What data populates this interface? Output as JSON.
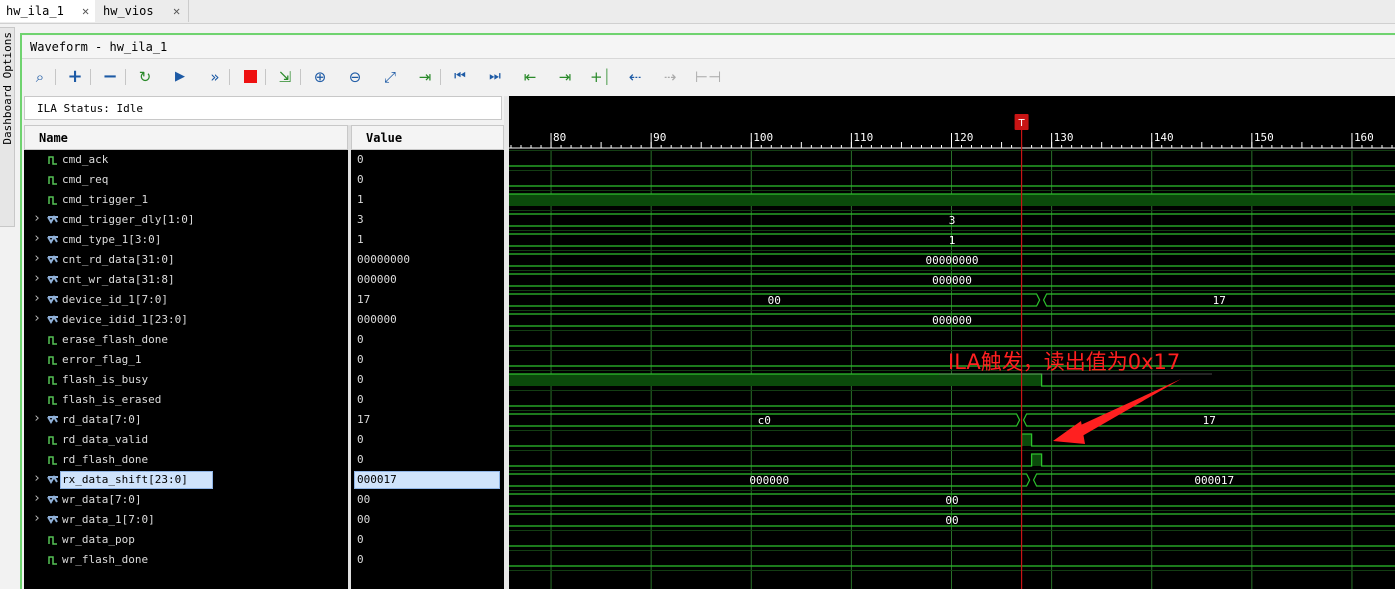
{
  "tabs": [
    {
      "label": "hw_ila_1",
      "active": true
    },
    {
      "label": "hw_vios",
      "active": false
    }
  ],
  "side_panel": {
    "label": "Dashboard Options"
  },
  "window": {
    "title": "Waveform - hw_ila_1"
  },
  "toolbar": {
    "buttons": [
      "search-icon",
      "plus-icon",
      "minus-icon",
      "reset-icon",
      "run-icon",
      "run-all-icon",
      "stop-icon",
      "export-icon",
      "zoom-in-icon",
      "zoom-out-icon",
      "zoom-fit-icon",
      "go-to-cursor-icon",
      "first-icon",
      "last-icon",
      "prev-transition-icon",
      "next-transition-icon",
      "add-marker-icon",
      "prev-marker-icon",
      "next-marker-icon",
      "swap-cursors-icon"
    ]
  },
  "status": {
    "text": "ILA Status: Idle"
  },
  "columns": {
    "name": "Name",
    "value": "Value"
  },
  "signals": [
    {
      "name": "cmd_ack",
      "value": "0",
      "type": "bit",
      "bus": false,
      "wave": [
        [
          60,
          "0"
        ]
      ]
    },
    {
      "name": "cmd_req",
      "value": "0",
      "type": "bit",
      "bus": false,
      "wave": [
        [
          60,
          "0"
        ]
      ]
    },
    {
      "name": "cmd_trigger_1",
      "value": "1",
      "type": "bit",
      "bus": false,
      "wave": [
        [
          60,
          "1"
        ]
      ]
    },
    {
      "name": "cmd_trigger_dly[1:0]",
      "value": "3",
      "type": "bus",
      "bus": true,
      "wave": [
        [
          60,
          "3"
        ]
      ]
    },
    {
      "name": "cmd_type_1[3:0]",
      "value": "1",
      "type": "bus",
      "bus": true,
      "wave": [
        [
          60,
          "1"
        ]
      ]
    },
    {
      "name": "cnt_rd_data[31:0]",
      "value": "00000000",
      "type": "bus",
      "bus": true,
      "wave": [
        [
          60,
          "00000000"
        ]
      ]
    },
    {
      "name": "cnt_wr_data[31:8]",
      "value": "000000",
      "type": "bus",
      "bus": true,
      "wave": [
        [
          60,
          "000000"
        ]
      ]
    },
    {
      "name": "device_id_1[7:0]",
      "value": "17",
      "type": "bus",
      "bus": true,
      "wave": [
        [
          60,
          "00"
        ],
        [
          129,
          "17"
        ]
      ]
    },
    {
      "name": "device_idid_1[23:0]",
      "value": "000000",
      "type": "bus",
      "bus": true,
      "wave": [
        [
          60,
          "000000"
        ]
      ]
    },
    {
      "name": "erase_flash_done",
      "value": "0",
      "type": "bit",
      "bus": false,
      "wave": [
        [
          60,
          "0"
        ]
      ]
    },
    {
      "name": "error_flag_1",
      "value": "0",
      "type": "bit",
      "bus": false,
      "wave": [
        [
          60,
          "0"
        ]
      ]
    },
    {
      "name": "flash_is_busy",
      "value": "0",
      "type": "bit",
      "bus": false,
      "wave": [
        [
          60,
          "1"
        ],
        [
          129,
          "0"
        ]
      ]
    },
    {
      "name": "flash_is_erased",
      "value": "0",
      "type": "bit",
      "bus": false,
      "wave": [
        [
          60,
          "0"
        ]
      ]
    },
    {
      "name": "rd_data[7:0]",
      "value": "17",
      "type": "bus",
      "bus": true,
      "wave": [
        [
          60,
          "c0"
        ],
        [
          127,
          "17"
        ]
      ]
    },
    {
      "name": "rd_data_valid",
      "value": "0",
      "type": "bit",
      "bus": false,
      "wave": [
        [
          60,
          "0"
        ],
        [
          127,
          "1"
        ],
        [
          128,
          "0"
        ]
      ]
    },
    {
      "name": "rd_flash_done",
      "value": "0",
      "type": "bit",
      "bus": false,
      "wave": [
        [
          60,
          "0"
        ],
        [
          128,
          "1"
        ],
        [
          129,
          "0"
        ]
      ]
    },
    {
      "name": "rx_data_shift[23:0]",
      "value": "000017",
      "type": "bus",
      "bus": true,
      "selected": true,
      "wave": [
        [
          60,
          "000000"
        ],
        [
          128,
          "000017"
        ]
      ]
    },
    {
      "name": "wr_data[7:0]",
      "value": "00",
      "type": "bus",
      "bus": true,
      "wave": [
        [
          60,
          "00"
        ]
      ]
    },
    {
      "name": "wr_data_1[7:0]",
      "value": "00",
      "type": "bus",
      "bus": true,
      "wave": [
        [
          60,
          "00"
        ]
      ]
    },
    {
      "name": "wr_data_pop",
      "value": "0",
      "type": "bit",
      "bus": false,
      "wave": [
        [
          60,
          "0"
        ]
      ]
    },
    {
      "name": "wr_flash_done",
      "value": "0",
      "type": "bit",
      "bus": false,
      "wave": [
        [
          60,
          "0"
        ]
      ]
    }
  ],
  "timeline": {
    "start": 75.8,
    "end": 164.3,
    "ticks": [
      80,
      90,
      100,
      110,
      120,
      130,
      140,
      150,
      160
    ],
    "trigger": 127,
    "trigger_label": "T"
  },
  "annotation": {
    "text": "ILA触发，读出值为0x17"
  },
  "colors": {
    "trace": "#2cc12c",
    "fill": "#0b4a0b",
    "grid": "#2e7d2e",
    "trigger": "#c81414",
    "annotation": "#ff2020"
  }
}
